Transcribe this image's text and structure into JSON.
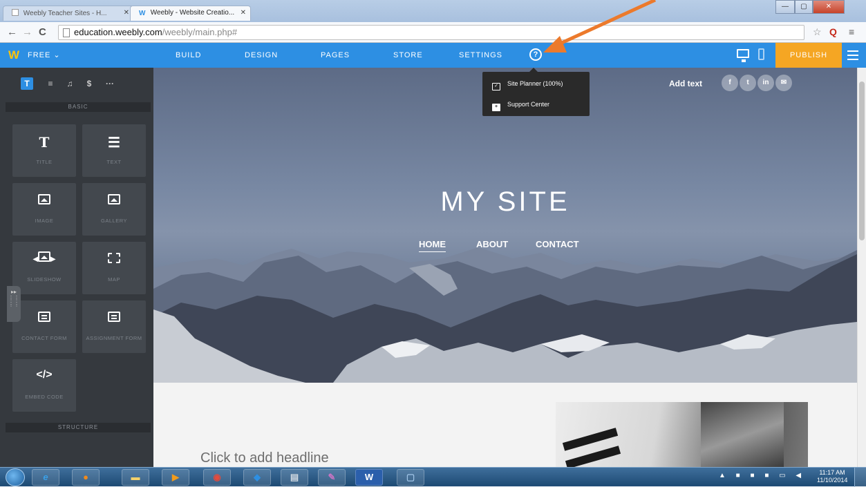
{
  "browser": {
    "tabs": [
      {
        "label": "Weebly Teacher Sites - H...",
        "active": false
      },
      {
        "label": "Weebly - Website Creatio...",
        "active": true
      }
    ],
    "url_host": "education.weebly.com",
    "url_path": "/weebly/main.php#",
    "window_controls": {
      "minimize": "—",
      "maximize": "▢",
      "close": "✕"
    }
  },
  "weebly_nav": {
    "plan_label": "FREE ⌄",
    "items": [
      "BUILD",
      "DESIGN",
      "PAGES",
      "STORE",
      "SETTINGS"
    ],
    "help_label": "?",
    "publish_label": "PUBLISH"
  },
  "help_menu": {
    "items": [
      {
        "label": "Site Planner (100%)",
        "icon": "planner-icon"
      },
      {
        "label": "Support Center",
        "icon": "support-icon"
      }
    ]
  },
  "sidebar": {
    "tabs": [
      "T",
      "≡",
      "♫",
      "$",
      "···"
    ],
    "section_basic": "BASIC",
    "elements": [
      {
        "label": "TITLE",
        "icon": "title-icon"
      },
      {
        "label": "TEXT",
        "icon": "text-icon"
      },
      {
        "label": "IMAGE",
        "icon": "image-icon"
      },
      {
        "label": "GALLERY",
        "icon": "gallery-icon"
      },
      {
        "label": "SLIDESHOW",
        "icon": "slideshow-icon"
      },
      {
        "label": "MAP",
        "icon": "map-icon"
      },
      {
        "label": "CONTACT FORM",
        "icon": "contact-form-icon"
      },
      {
        "label": "ASSIGNMENT FORM",
        "icon": "assignment-form-icon"
      },
      {
        "label": "EMBED CODE",
        "icon": "embed-code-icon"
      }
    ],
    "section_structure": "STRUCTURE"
  },
  "site": {
    "title": "MY SITE",
    "nav": [
      "HOME",
      "ABOUT",
      "CONTACT"
    ],
    "add_text": "Add text",
    "social": [
      "f",
      "t",
      "in",
      "✉"
    ],
    "headline_placeholder": "Click to add headline"
  },
  "taskbar": {
    "clock_time": "11:17 AM",
    "clock_date": "11/10/2014"
  },
  "colors": {
    "weebly_blue": "#2d8fe3",
    "publish_orange": "#f5a623",
    "sidebar_dark": "#35393e",
    "annotation_arrow": "#ec7a2c"
  }
}
